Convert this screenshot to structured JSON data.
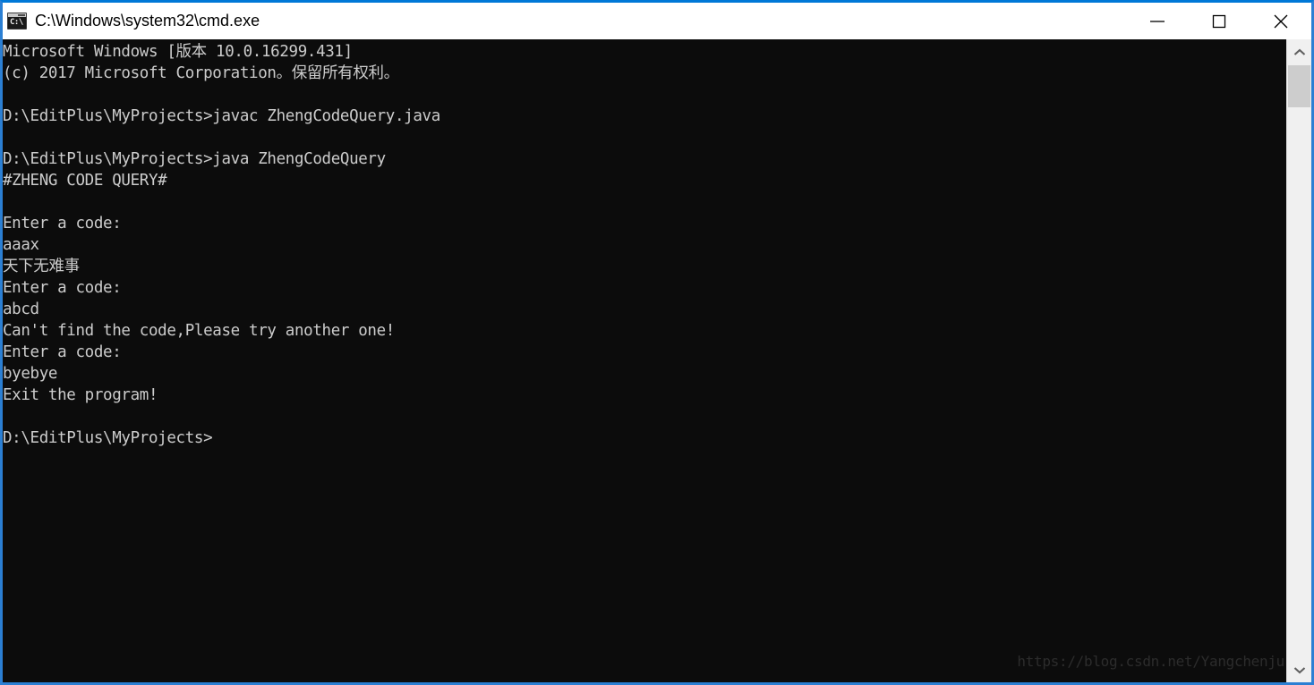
{
  "window": {
    "title": "C:\\Windows\\system32\\cmd.exe",
    "icon": "cmd-icon",
    "icon_text": "C:\\",
    "accent_color": "#0078d7",
    "border_color": "#2b7fd3",
    "titlebar_bg": "#ffffff",
    "titlebar_fg": "#000000",
    "controls": {
      "minimize_label": "Minimize",
      "maximize_label": "Maximize",
      "close_label": "Close"
    }
  },
  "console": {
    "background_color": "#0c0c0c",
    "text_color": "#cccccc",
    "lines": [
      "Microsoft Windows [版本 10.0.16299.431]",
      "(c) 2017 Microsoft Corporation。保留所有权利。",
      "",
      "D:\\EditPlus\\MyProjects>javac ZhengCodeQuery.java",
      "",
      "D:\\EditPlus\\MyProjects>java ZhengCodeQuery",
      "#ZHENG CODE QUERY#",
      "",
      "Enter a code:",
      "aaax",
      "天下无难事",
      "Enter a code:",
      "abcd",
      "Can't find the code,Please try another one!",
      "Enter a code:",
      "byebye",
      "Exit the program!",
      "",
      "D:\\EditPlus\\MyProjects>"
    ],
    "text": "Microsoft Windows [版本 10.0.16299.431]\n(c) 2017 Microsoft Corporation。保留所有权利。\n\nD:\\EditPlus\\MyProjects>javac ZhengCodeQuery.java\n\nD:\\EditPlus\\MyProjects>java ZhengCodeQuery\n#ZHENG CODE QUERY#\n\nEnter a code:\naaax\n天下无难事\nEnter a code:\nabcd\nCan't find the code,Please try another one!\nEnter a code:\nbyebye\nExit the program!\n\nD:\\EditPlus\\MyProjects>",
    "watermark": "https://blog.csdn.net/Yangchenju",
    "watermark_color": "#2c2c2c"
  },
  "scrollbar": {
    "track_color": "#f0f0f0",
    "thumb_color": "#cdcdcd",
    "up_arrow": "chevron-up-icon",
    "down_arrow": "chevron-down-icon"
  }
}
